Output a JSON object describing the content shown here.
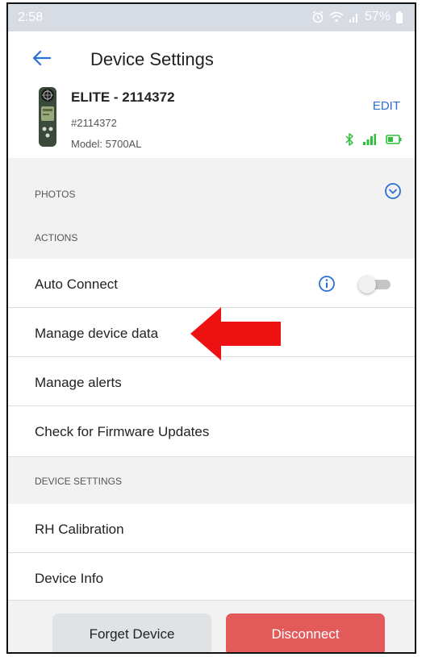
{
  "status_bar": {
    "time": "2:58",
    "battery": "57%"
  },
  "app_bar": {
    "title": "Device Settings"
  },
  "device": {
    "name": "ELITE - 2114372",
    "serial": "#2114372",
    "model": "Model: 5700AL",
    "edit_label": "EDIT"
  },
  "sections": {
    "photos": "PHOTOS",
    "actions": "ACTIONS",
    "device_settings": "DEVICE SETTINGS"
  },
  "actions": {
    "auto_connect": "Auto Connect",
    "auto_connect_enabled": false,
    "manage_device_data": "Manage device data",
    "manage_alerts": "Manage alerts",
    "check_firmware": "Check for Firmware Updates"
  },
  "device_settings": {
    "rh_calibration": "RH Calibration",
    "device_info": "Device Info"
  },
  "buttons": {
    "forget": "Forget Device",
    "disconnect": "Disconnect"
  },
  "icons": {
    "back": "arrow-left-icon",
    "photos_toggle": "chevron-down-circle-icon",
    "info": "info-circle-icon",
    "bluetooth": "bluetooth-icon",
    "signal": "signal-bars-icon",
    "battery": "battery-icon",
    "annotation": "red-arrow-icon"
  },
  "colors": {
    "accent_blue": "#2a6fd6",
    "status_green": "#2fbf3a",
    "disconnect_red": "#e25a5a",
    "annotation_red": "#ee1111"
  }
}
